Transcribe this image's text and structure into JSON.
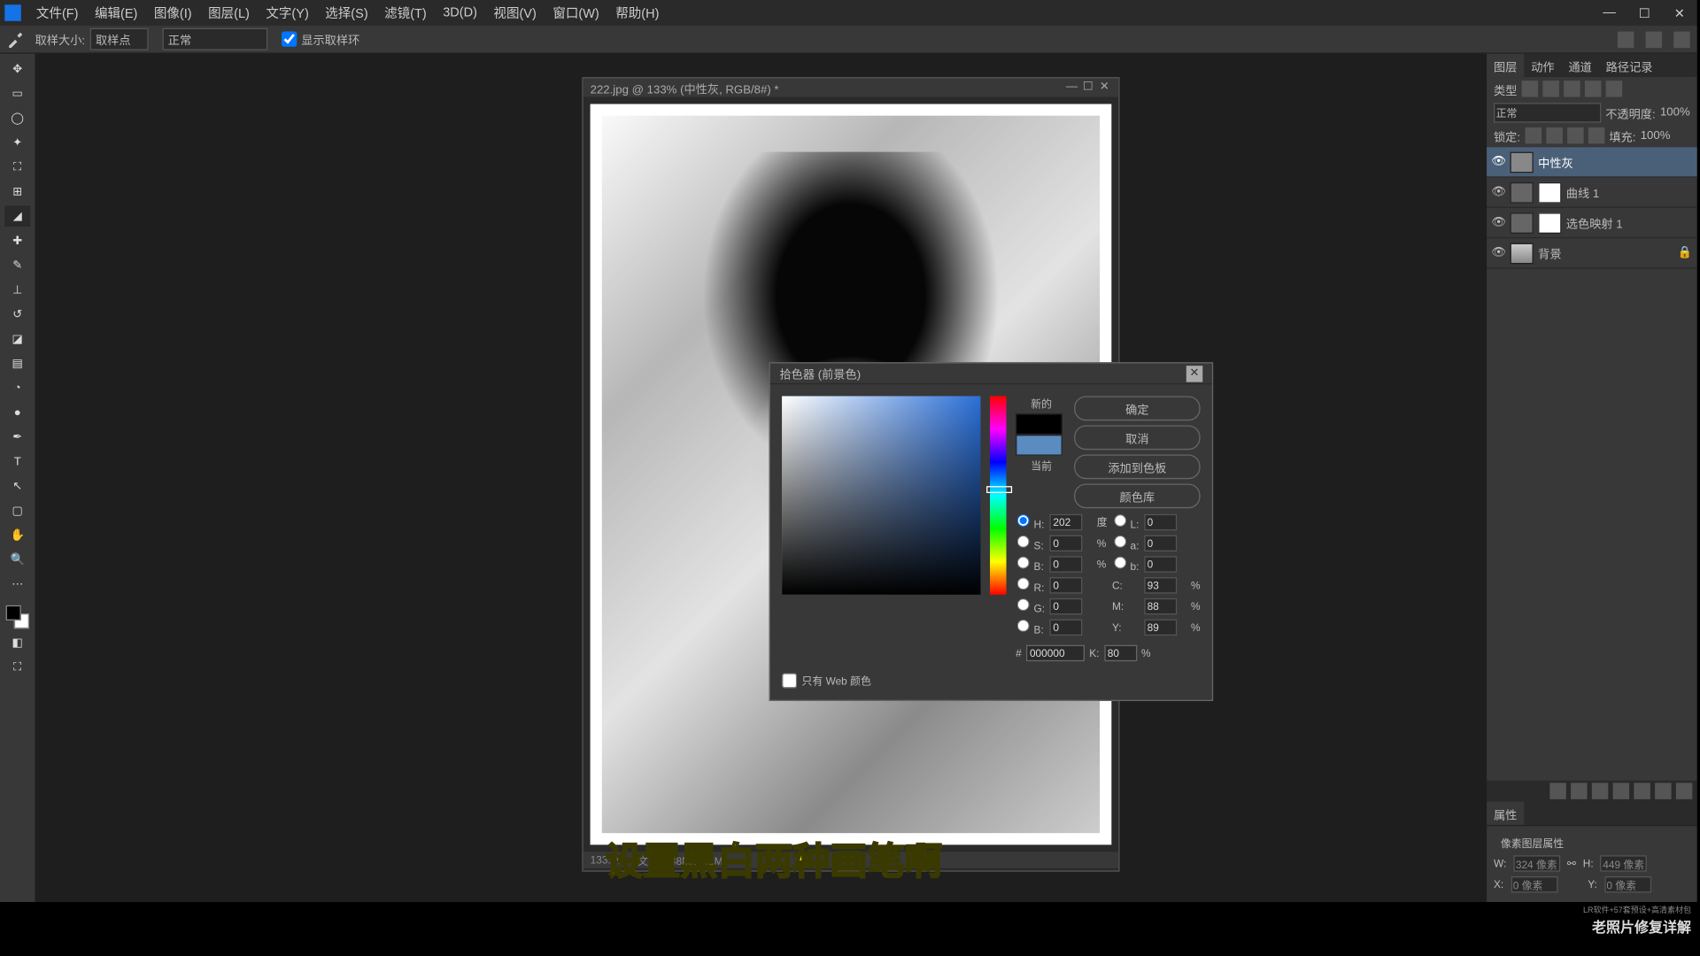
{
  "menu": {
    "file": "文件(F)",
    "edit": "编辑(E)",
    "image": "图像(I)",
    "layer": "图层(L)",
    "type": "文字(Y)",
    "select": "选择(S)",
    "filter": "滤镜(T)",
    "threeD": "3D(D)",
    "view": "视图(V)",
    "window": "窗口(W)",
    "help": "帮助(H)"
  },
  "optbar": {
    "sampleSize": "取样大小:",
    "sampleSizeVal": "取样点",
    "sample": "正常",
    "showRing": "显示取样环"
  },
  "doc": {
    "title": "222.jpg @ 133% (中性灰, RGB/8#) *",
    "zoom": "133.1%",
    "size": "文档:1.48M/1.48M"
  },
  "picker": {
    "title": "拾色器 (前景色)",
    "ok": "确定",
    "cancel": "取消",
    "addSwatch": "添加到色板",
    "colorLib": "颜色库",
    "new": "新的",
    "current": "当前",
    "webOnly": "只有 Web 颜色",
    "H": "H:",
    "Hval": "202",
    "Hdeg": "度",
    "S": "S:",
    "Sval": "0",
    "pct": "%",
    "Bv": "B:",
    "Bval": "0",
    "L": "L:",
    "Lval": "0",
    "a": "a:",
    "aval": "0",
    "b": "b:",
    "bval": "0",
    "R": "R:",
    "Rval": "0",
    "G": "G:",
    "Gval": "0",
    "Bb": "B:",
    "Bbval": "0",
    "C": "C:",
    "Cval": "93",
    "M": "M:",
    "Mval": "88",
    "Y": "Y:",
    "Yval": "89",
    "K": "K:",
    "Kval": "80",
    "hex": "#",
    "hexval": "000000"
  },
  "panels": {
    "layersTab": "图层",
    "actionsTab": "动作",
    "historyTab": "通道",
    "pathsTab": "路径记录",
    "kind": "类型",
    "opacity": "不透明度:",
    "opacityVal": "100%",
    "fill": "填充:",
    "fillVal": "100%",
    "lock": "锁定:",
    "l1": "中性灰",
    "l2": "曲线 1",
    "l3": "选色映射 1",
    "l4": "背景",
    "propsTab": "属性",
    "propsSub": "像素图层属性",
    "W": "W:",
    "Wval": "324 像素",
    "H": "H:",
    "Hval": "449 像素",
    "X": "X:",
    "Xval": "0 像素",
    "Y": "Y:",
    "Yval": "0 像素"
  },
  "caption": "设置黑白两种画笔啊",
  "watermark": {
    "sm": "LR软件+57套预设+高清素材包",
    "lg": "老照片修复详解"
  }
}
